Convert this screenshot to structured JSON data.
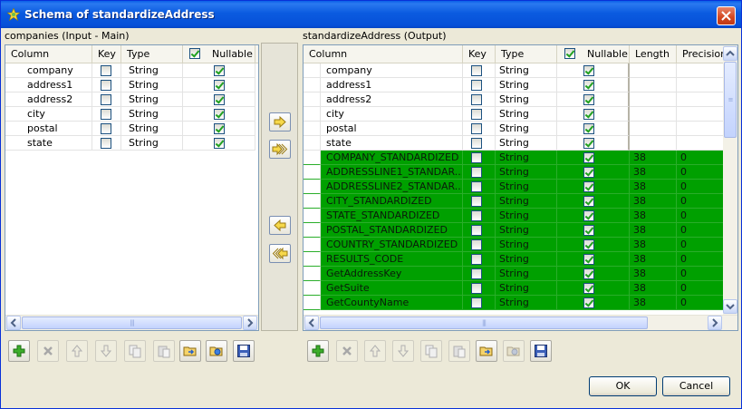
{
  "window": {
    "title": "Schema of standardizeAddress"
  },
  "left": {
    "label": "companies (Input - Main)",
    "headers": {
      "column": "Column",
      "key": "Key",
      "type": "Type",
      "nullable": "Nullable"
    },
    "header_nullable_checked": true,
    "rows": [
      {
        "column": "company",
        "key": false,
        "type": "String",
        "nullable": true
      },
      {
        "column": "address1",
        "key": false,
        "type": "String",
        "nullable": true
      },
      {
        "column": "address2",
        "key": false,
        "type": "String",
        "nullable": true
      },
      {
        "column": "city",
        "key": false,
        "type": "String",
        "nullable": true
      },
      {
        "column": "postal",
        "key": false,
        "type": "String",
        "nullable": true
      },
      {
        "column": "state",
        "key": false,
        "type": "String",
        "nullable": true
      }
    ]
  },
  "right": {
    "label": "standardizeAddress (Output)",
    "headers": {
      "column": "Column",
      "key": "Key",
      "type": "Type",
      "nullable": "Nullable",
      "length": "Length",
      "precision": "Precision"
    },
    "header_nullable_checked": true,
    "rows": [
      {
        "column": "company",
        "key": false,
        "type": "String",
        "nullable": true,
        "length": "",
        "precision": "",
        "highlight": false
      },
      {
        "column": "address1",
        "key": false,
        "type": "String",
        "nullable": true,
        "length": "",
        "precision": "",
        "highlight": false
      },
      {
        "column": "address2",
        "key": false,
        "type": "String",
        "nullable": true,
        "length": "",
        "precision": "",
        "highlight": false
      },
      {
        "column": "city",
        "key": false,
        "type": "String",
        "nullable": true,
        "length": "",
        "precision": "",
        "highlight": false
      },
      {
        "column": "postal",
        "key": false,
        "type": "String",
        "nullable": true,
        "length": "",
        "precision": "",
        "highlight": false
      },
      {
        "column": "state",
        "key": false,
        "type": "String",
        "nullable": true,
        "length": "",
        "precision": "",
        "highlight": false
      },
      {
        "column": "COMPANY_STANDARDIZED",
        "key": false,
        "type": "String",
        "nullable": true,
        "length": "38",
        "precision": "0",
        "highlight": true
      },
      {
        "column": "ADDRESSLINE1_STANDAR...",
        "key": false,
        "type": "String",
        "nullable": true,
        "length": "38",
        "precision": "0",
        "highlight": true
      },
      {
        "column": "ADDRESSLINE2_STANDAR...",
        "key": false,
        "type": "String",
        "nullable": true,
        "length": "38",
        "precision": "0",
        "highlight": true
      },
      {
        "column": "CITY_STANDARDIZED",
        "key": false,
        "type": "String",
        "nullable": true,
        "length": "38",
        "precision": "0",
        "highlight": true
      },
      {
        "column": "STATE_STANDARDIZED",
        "key": false,
        "type": "String",
        "nullable": true,
        "length": "38",
        "precision": "0",
        "highlight": true
      },
      {
        "column": "POSTAL_STANDARDIZED",
        "key": false,
        "type": "String",
        "nullable": true,
        "length": "38",
        "precision": "0",
        "highlight": true
      },
      {
        "column": "COUNTRY_STANDARDIZED",
        "key": false,
        "type": "String",
        "nullable": true,
        "length": "38",
        "precision": "0",
        "highlight": true
      },
      {
        "column": "RESULTS_CODE",
        "key": false,
        "type": "String",
        "nullable": true,
        "length": "38",
        "precision": "0",
        "highlight": true
      },
      {
        "column": "GetAddressKey",
        "key": false,
        "type": "String",
        "nullable": true,
        "length": "38",
        "precision": "0",
        "highlight": true
      },
      {
        "column": "GetSuite",
        "key": false,
        "type": "String",
        "nullable": true,
        "length": "38",
        "precision": "0",
        "highlight": true
      },
      {
        "column": "GetCountyName",
        "key": false,
        "type": "String",
        "nullable": true,
        "length": "38",
        "precision": "0",
        "highlight": true
      }
    ]
  },
  "toolbar": {
    "left_icons": [
      "add-icon",
      "remove-icon",
      "move-up-icon",
      "move-down-icon",
      "copy-icon",
      "paste-icon",
      "import-icon",
      "export-icon",
      "save-icon"
    ],
    "right_icons": [
      "add-icon",
      "remove-icon",
      "move-up-icon",
      "move-down-icon",
      "copy-icon",
      "paste-icon",
      "import-icon",
      "export-icon",
      "save-icon"
    ]
  },
  "buttons": {
    "ok": "OK",
    "cancel": "Cancel"
  },
  "colors": {
    "highlight_row": "#00a000",
    "title_bar": "#0a5fe8"
  }
}
